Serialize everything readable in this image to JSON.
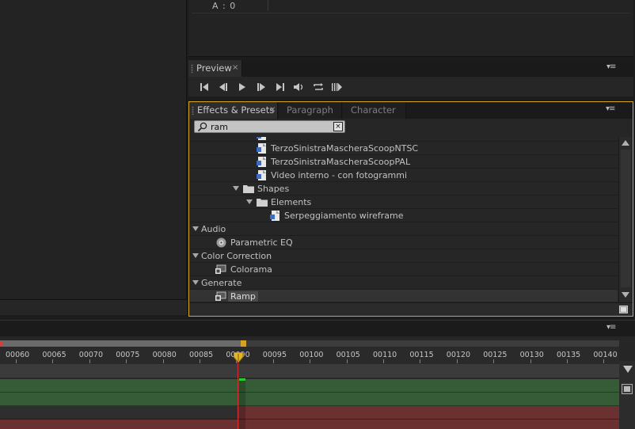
{
  "info": {
    "alpha_readout": "A :  0"
  },
  "preview": {
    "tab_label": "Preview",
    "close_glyph": "×",
    "menu_glyph": "▾≡",
    "controls": [
      "first-frame-icon",
      "previous-frame-icon",
      "play-icon",
      "next-frame-icon",
      "last-frame-icon",
      "mute-audio-icon",
      "loop-icon",
      "ram-preview-icon"
    ]
  },
  "effects": {
    "tabs": [
      {
        "label": "Effects & Presets",
        "active": true
      },
      {
        "label": "Paragraph",
        "active": false
      },
      {
        "label": "Character",
        "active": false
      }
    ],
    "close_glyph": "×",
    "menu_glyph": "▾≡",
    "search": {
      "value": "ram",
      "clear_glyph": "×"
    },
    "tree": [
      {
        "label": "",
        "type": "preset",
        "level": 2
      },
      {
        "label": "TerzoSinistraMascheraScoopNTSC",
        "type": "preset",
        "level": 2
      },
      {
        "label": "TerzoSinistraMascheraScoopPAL",
        "type": "preset",
        "level": 2
      },
      {
        "label": "Video interno - con fotogrammi",
        "type": "preset",
        "level": 2
      },
      {
        "label": "Shapes",
        "type": "folder",
        "level": 1
      },
      {
        "label": "Elements",
        "type": "folder",
        "level": 2
      },
      {
        "label": "Serpeggiamento wireframe",
        "type": "preset",
        "level": 3
      },
      {
        "label": "Audio",
        "type": "category",
        "level": 0
      },
      {
        "label": "Parametric EQ",
        "type": "effect-audio",
        "level": 1
      },
      {
        "label": "Color Correction",
        "type": "category",
        "level": 0
      },
      {
        "label": "Colorama",
        "type": "effect",
        "level": 1
      },
      {
        "label": "Generate",
        "type": "category",
        "level": 0
      },
      {
        "label": "Ramp",
        "type": "effect",
        "level": 1,
        "selected": true
      }
    ]
  },
  "timeline": {
    "menu_glyph": "▾≡",
    "ruler_labels": [
      "00060",
      "00065",
      "00070",
      "00075",
      "00080",
      "00085",
      "00090",
      "00095",
      "00100",
      "00105",
      "00110",
      "00115",
      "00120",
      "00125",
      "00130",
      "00135",
      "00140"
    ],
    "colors": {
      "green_track": "#365c37",
      "red_track": "#6b3030",
      "playhead": "#d03030",
      "work_area_end": "#d4a326"
    }
  }
}
